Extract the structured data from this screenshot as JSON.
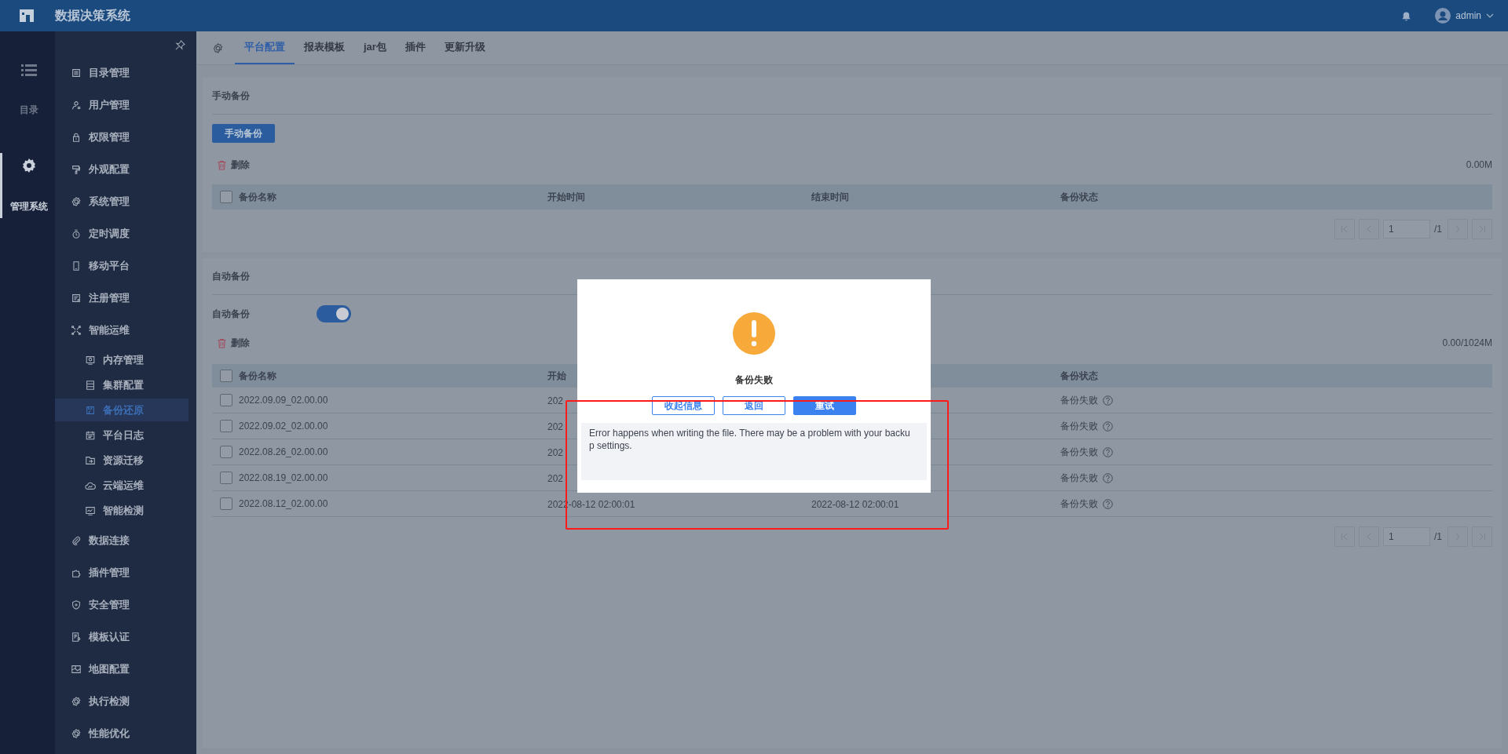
{
  "app": {
    "title": "数据决策系统",
    "user": "admin"
  },
  "rail": [
    {
      "label": "目录",
      "selected": false
    },
    {
      "label": "管理系统",
      "selected": true
    }
  ],
  "sidebar": {
    "items": [
      {
        "label": "目录管理",
        "selected": false
      },
      {
        "label": "用户管理",
        "selected": false
      },
      {
        "label": "权限管理",
        "selected": false
      },
      {
        "label": "外观配置",
        "selected": false
      },
      {
        "label": "系统管理",
        "selected": false
      },
      {
        "label": "定时调度",
        "selected": false
      },
      {
        "label": "移动平台",
        "selected": false
      },
      {
        "label": "注册管理",
        "selected": false
      },
      {
        "label": "智能运维",
        "selected": false,
        "children": [
          {
            "label": "内存管理",
            "selected": false
          },
          {
            "label": "集群配置",
            "selected": false
          },
          {
            "label": "备份还原",
            "selected": true
          },
          {
            "label": "平台日志",
            "selected": false
          },
          {
            "label": "资源迁移",
            "selected": false
          },
          {
            "label": "云端运维",
            "selected": false
          },
          {
            "label": "智能检测",
            "selected": false
          }
        ]
      },
      {
        "label": "数据连接",
        "selected": false
      },
      {
        "label": "插件管理",
        "selected": false
      },
      {
        "label": "安全管理",
        "selected": false
      },
      {
        "label": "模板认证",
        "selected": false
      },
      {
        "label": "地图配置",
        "selected": false
      },
      {
        "label": "执行检测",
        "selected": false
      },
      {
        "label": "性能优化",
        "selected": false
      }
    ]
  },
  "tabs": [
    {
      "label": "平台配置",
      "selected": true
    },
    {
      "label": "报表模板",
      "selected": false
    },
    {
      "label": "jar包",
      "selected": false
    },
    {
      "label": "插件",
      "selected": false
    },
    {
      "label": "更新升级",
      "selected": false
    }
  ],
  "manual_backup": {
    "title": "手动备份",
    "button": "手动备份",
    "delete": "删除",
    "usage": "0.00M",
    "select_all_checked": false,
    "columns": [
      "备份名称",
      "开始时间",
      "结束时间",
      "备份状态"
    ],
    "pagination": {
      "page": "1",
      "total": "/1"
    }
  },
  "auto_backup": {
    "title": "自动备份",
    "toggle_label": "自动备份",
    "on": true,
    "delete": "删除",
    "usage": "0.00/1024M",
    "select_all_checked": false,
    "columns": [
      "备份名称",
      "开始",
      "备份状态"
    ],
    "rows": [
      {
        "name": "2022.09.09_02.00.00",
        "checked": false,
        "start_time": "202",
        "status": "备份失败"
      },
      {
        "name": "2022.09.02_02.00.00",
        "checked": false,
        "start_time": "202",
        "status": "备份失败"
      },
      {
        "name": "2022.08.26_02.00.00",
        "checked": false,
        "start_time": "202",
        "status": "备份失败"
      },
      {
        "name": "2022.08.19_02.00.00",
        "checked": false,
        "start_time": "202",
        "status": "备份失败"
      },
      {
        "name": "2022.08.12_02.00.00",
        "checked": false,
        "start_time": "2022-08-12 02:00:01",
        "end_time": "2022-08-12 02:00:01",
        "status": "备份失败"
      }
    ],
    "pagination": {
      "page": "1",
      "total": "/1"
    }
  },
  "dialog": {
    "title": "备份失败",
    "buttons": [
      {
        "label": "收起信息",
        "kind": "outline"
      },
      {
        "label": "返回",
        "kind": "outline"
      },
      {
        "label": "重试",
        "kind": "primary"
      }
    ],
    "message": "Error happens when writing the file. There may be a problem with your backup settings."
  }
}
